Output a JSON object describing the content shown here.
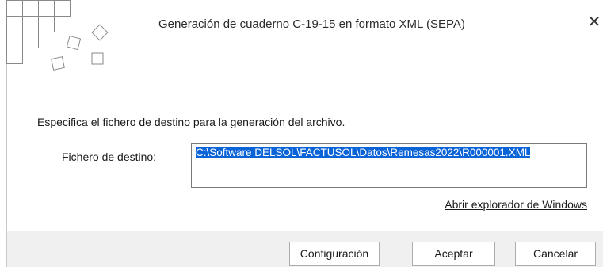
{
  "dialog": {
    "title": "Generación de cuaderno C-19-15 en formato XML (SEPA)",
    "close_glyph": "✕"
  },
  "content": {
    "description": "Especifica el fichero de destino para la generación del archivo.",
    "destination_label": "Fichero de destino:",
    "destination_value": "C:\\Software DELSOL\\FACTUSOL\\Datos\\Remesas2022\\R000001.XML",
    "destination_value_selected": true,
    "explorer_link": "Abrir explorador de Windows"
  },
  "buttons": {
    "config": "Configuración",
    "accept": "Aceptar",
    "cancel": "Cancelar"
  },
  "colors": {
    "selection": "#0a64d8",
    "footer": "#f0f0f0",
    "deco_stroke": "#8a8a8a"
  },
  "icons": {
    "logo": "grid-squares-logo-icon",
    "close": "close-icon"
  }
}
